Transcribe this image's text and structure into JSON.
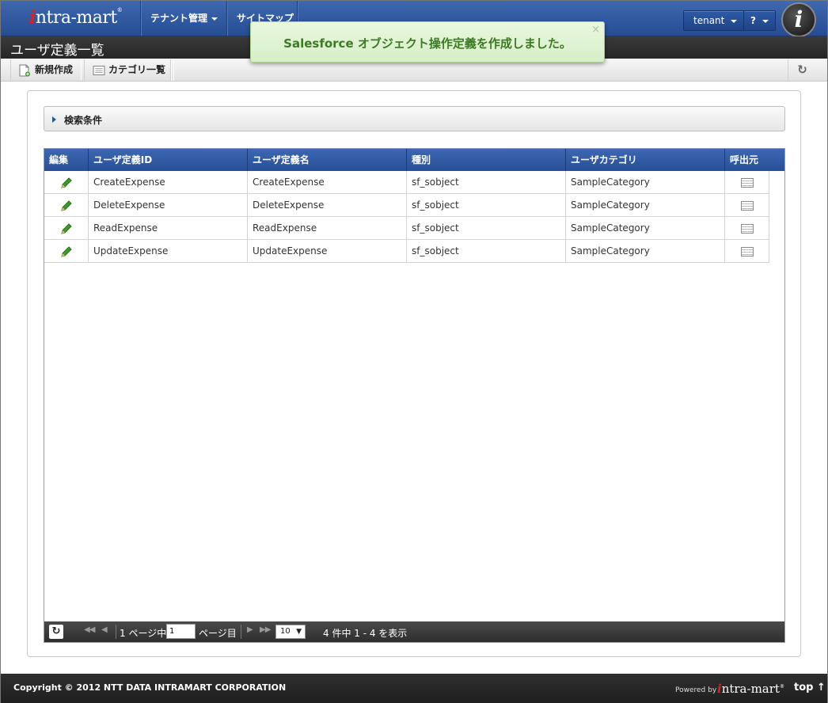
{
  "header": {
    "logo": "intra-mart",
    "nav": [
      {
        "label": "テナント管理",
        "has_dropdown": true
      },
      {
        "label": "サイトマップ",
        "has_dropdown": false
      }
    ],
    "user_button": "tenant",
    "help_button": "?",
    "badge_icon": "intra-mart-i-logo"
  },
  "notification": {
    "message": "Salesforce オブジェクト操作定義を作成しました。",
    "close": "×"
  },
  "page": {
    "title": "ユーザ定義一覧"
  },
  "toolbar": {
    "new_label": "新規作成",
    "category_label": "カテゴリ一覧"
  },
  "search": {
    "label": "検索条件"
  },
  "grid": {
    "columns": [
      "編集",
      "ユーザ定義ID",
      "ユーザ定義名",
      "種別",
      "ユーザカテゴリ",
      "呼出元"
    ],
    "rows": [
      {
        "id": "CreateExpense",
        "name": "CreateExpense",
        "type": "sf_sobject",
        "category": "SampleCategory"
      },
      {
        "id": "DeleteExpense",
        "name": "DeleteExpense",
        "type": "sf_sobject",
        "category": "SampleCategory"
      },
      {
        "id": "ReadExpense",
        "name": "ReadExpense",
        "type": "sf_sobject",
        "category": "SampleCategory"
      },
      {
        "id": "UpdateExpense",
        "name": "UpdateExpense",
        "type": "sf_sobject",
        "category": "SampleCategory"
      }
    ]
  },
  "pager": {
    "page_total_text": "1 ページ中",
    "page_input": "1",
    "page_suffix": "ページ目",
    "page_size": "10",
    "summary": "4 件中 1 - 4 を表示"
  },
  "footer": {
    "copyright": "Copyright © 2012 NTT DATA INTRAMART CORPORATION",
    "powered_by": "Powered by",
    "logo": "intra-mart",
    "top_link": "top ↑"
  },
  "colors": {
    "header_blue": "#2f5aa5",
    "notice_green": "#3c7a23"
  }
}
